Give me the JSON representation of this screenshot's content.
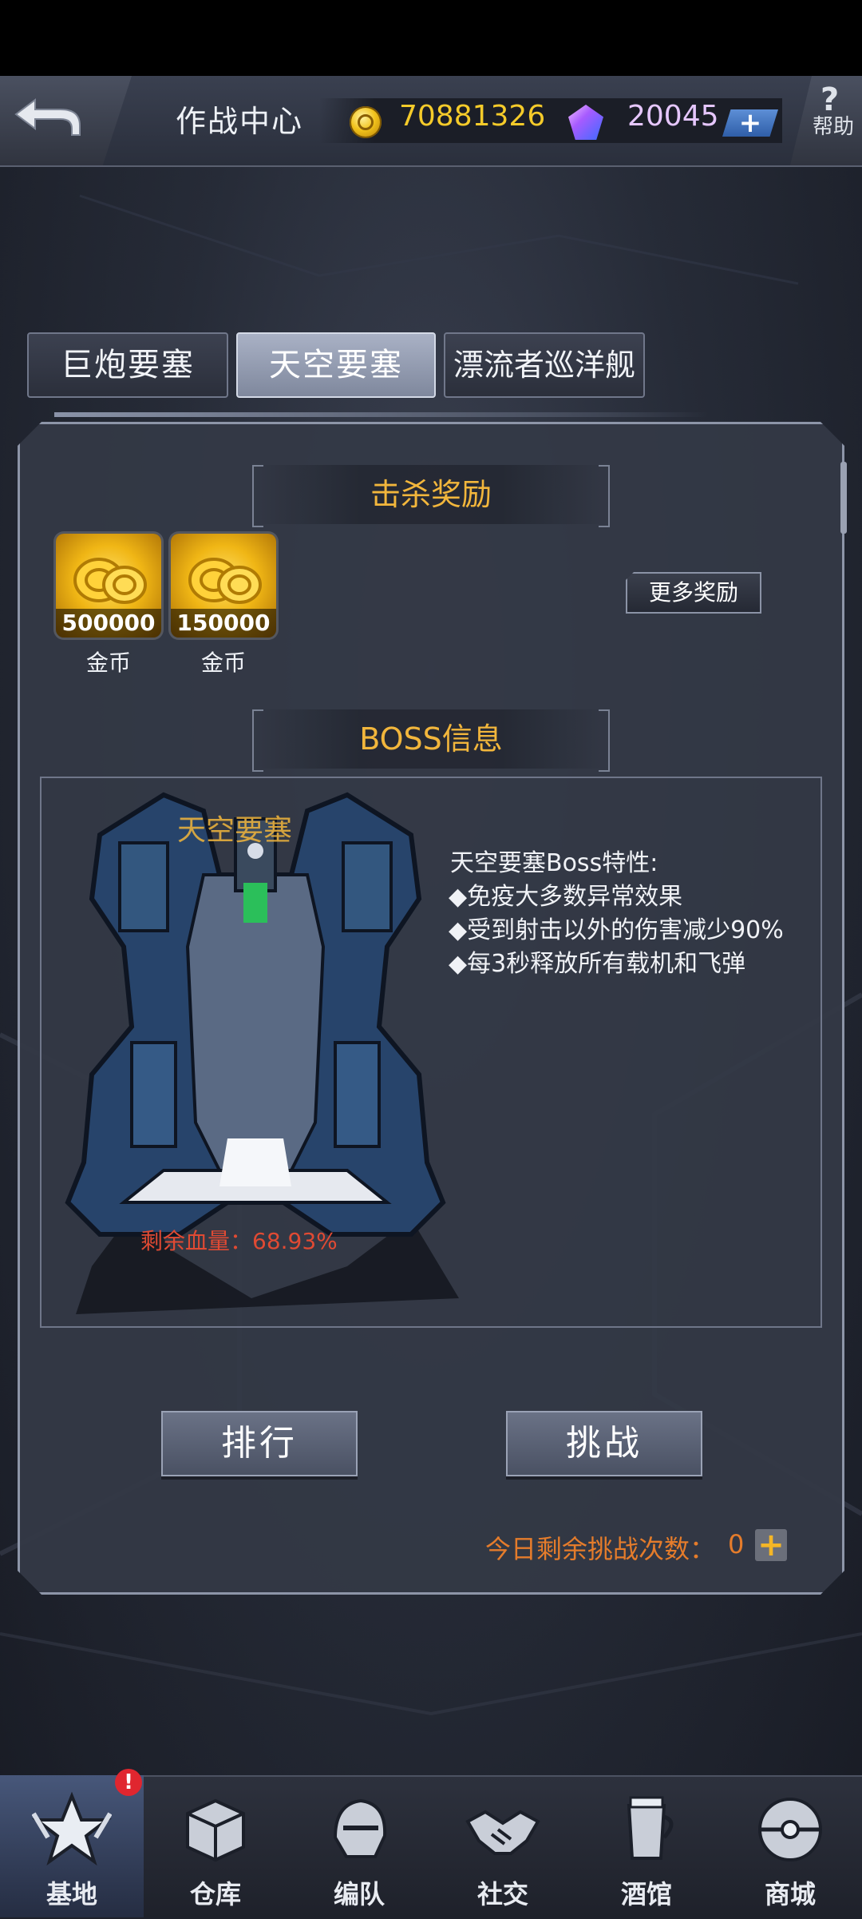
{
  "header": {
    "title": "作战中心",
    "coins": "70881326",
    "gems": "20045",
    "plus_label": "+",
    "help_icon": "?",
    "help_label": "帮助"
  },
  "tabs": [
    {
      "label": "巨炮要塞",
      "active": false
    },
    {
      "label": "天空要塞",
      "active": true
    },
    {
      "label": "漂流者巡洋舰",
      "active": false
    }
  ],
  "rewards": {
    "title": "击杀奖励",
    "items": [
      {
        "amount": "500000",
        "label": "金币",
        "icon": "gold-coins-icon"
      },
      {
        "amount": "150000",
        "label": "金币",
        "icon": "gold-coins-icon"
      }
    ],
    "more_label": "更多奖励"
  },
  "boss": {
    "section_title": "BOSS信息",
    "name_overlay": "天空要塞",
    "hp_text": "剩余血量：68.93%",
    "traits_title": "天空要塞Boss特性:",
    "traits": [
      "◆免疫大多数异常效果",
      "◆受到射击以外的伤害减少90%",
      "◆每3秒释放所有载机和飞弹"
    ]
  },
  "actions": {
    "rank_label": "排行",
    "challenge_label": "挑战",
    "remaining_label": "今日剩余挑战次数：",
    "remaining_count": "0",
    "add_label": "+"
  },
  "nav": [
    {
      "label": "基地",
      "icon": "base-star-icon",
      "active": true,
      "badge": "!"
    },
    {
      "label": "仓库",
      "icon": "warehouse-box-icon",
      "active": false
    },
    {
      "label": "编队",
      "icon": "squad-helmet-icon",
      "active": false
    },
    {
      "label": "社交",
      "icon": "handshake-icon",
      "active": false
    },
    {
      "label": "酒馆",
      "icon": "tavern-drink-icon",
      "active": false
    },
    {
      "label": "商城",
      "icon": "shop-capsule-icon",
      "active": false
    }
  ],
  "colors": {
    "accent_gold": "#f2b63c",
    "hp_red": "#e04a33",
    "remaining_orange": "#e57c2b"
  }
}
